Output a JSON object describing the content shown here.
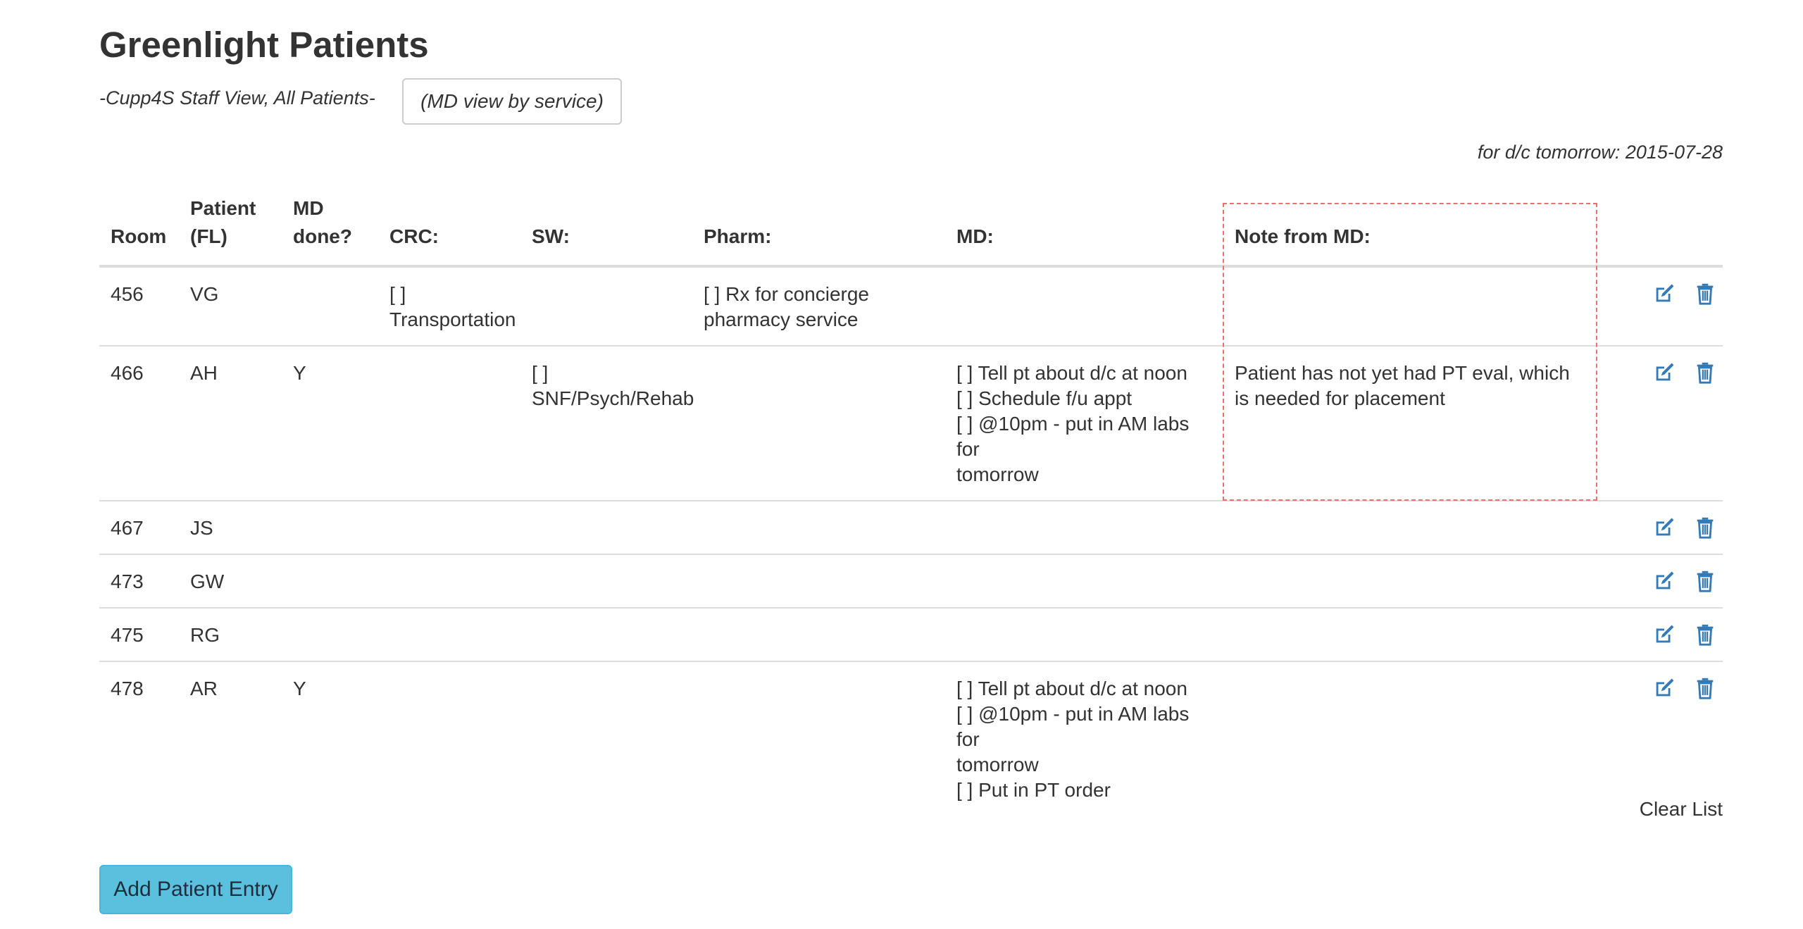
{
  "header": {
    "title": "Greenlight Patients",
    "subtitle": "-Cupp4S Staff View, All Patients-",
    "md_view_button": "(MD view by service)",
    "discharge_date": "for d/c tomorrow: 2015-07-28"
  },
  "table": {
    "columns": {
      "room": "Room",
      "patient_line1": "Patient",
      "patient_line2": "(FL)",
      "md_done_line1": "MD",
      "md_done_line2": "done?",
      "crc": "CRC:",
      "sw": "SW:",
      "pharm": "Pharm:",
      "md": "MD:",
      "note": "Note from MD:"
    },
    "rows": [
      {
        "room": "456",
        "patient": "VG",
        "md_done": "",
        "crc": [
          "[ ]",
          "Transportation"
        ],
        "sw": [],
        "pharm": [
          "[ ] Rx for concierge",
          "pharmacy service"
        ],
        "md": [],
        "note": ""
      },
      {
        "room": "466",
        "patient": "AH",
        "md_done": "Y",
        "crc": [],
        "sw": [
          "[ ]",
          "SNF/Psych/Rehab"
        ],
        "pharm": [],
        "md": [
          "[ ] Tell pt about d/c at noon",
          "[ ] Schedule f/u appt",
          "[ ] @10pm - put in AM labs for",
          "tomorrow"
        ],
        "note": "Patient has not yet had PT eval, which is needed for placement"
      },
      {
        "room": "467",
        "patient": "JS",
        "md_done": "",
        "crc": [],
        "sw": [],
        "pharm": [],
        "md": [],
        "note": ""
      },
      {
        "room": "473",
        "patient": "GW",
        "md_done": "",
        "crc": [],
        "sw": [],
        "pharm": [],
        "md": [],
        "note": ""
      },
      {
        "room": "475",
        "patient": "RG",
        "md_done": "",
        "crc": [],
        "sw": [],
        "pharm": [],
        "md": [],
        "note": ""
      },
      {
        "room": "478",
        "patient": "AR",
        "md_done": "Y",
        "crc": [],
        "sw": [],
        "pharm": [],
        "md": [
          "[ ] Tell pt about d/c at noon",
          "[ ] @10pm - put in AM labs for",
          "tomorrow",
          "[ ] Put in PT order"
        ],
        "note": ""
      }
    ],
    "row_icons": {
      "edit": "edit-icon",
      "delete": "trash-icon"
    }
  },
  "footer": {
    "clear_list": "Clear List",
    "add_button": "Add Patient Entry"
  },
  "colors": {
    "icon": "#337ab7",
    "add_button_bg": "#5bc0de",
    "highlight_border": "#e57373",
    "row_border": "#dddddd"
  }
}
